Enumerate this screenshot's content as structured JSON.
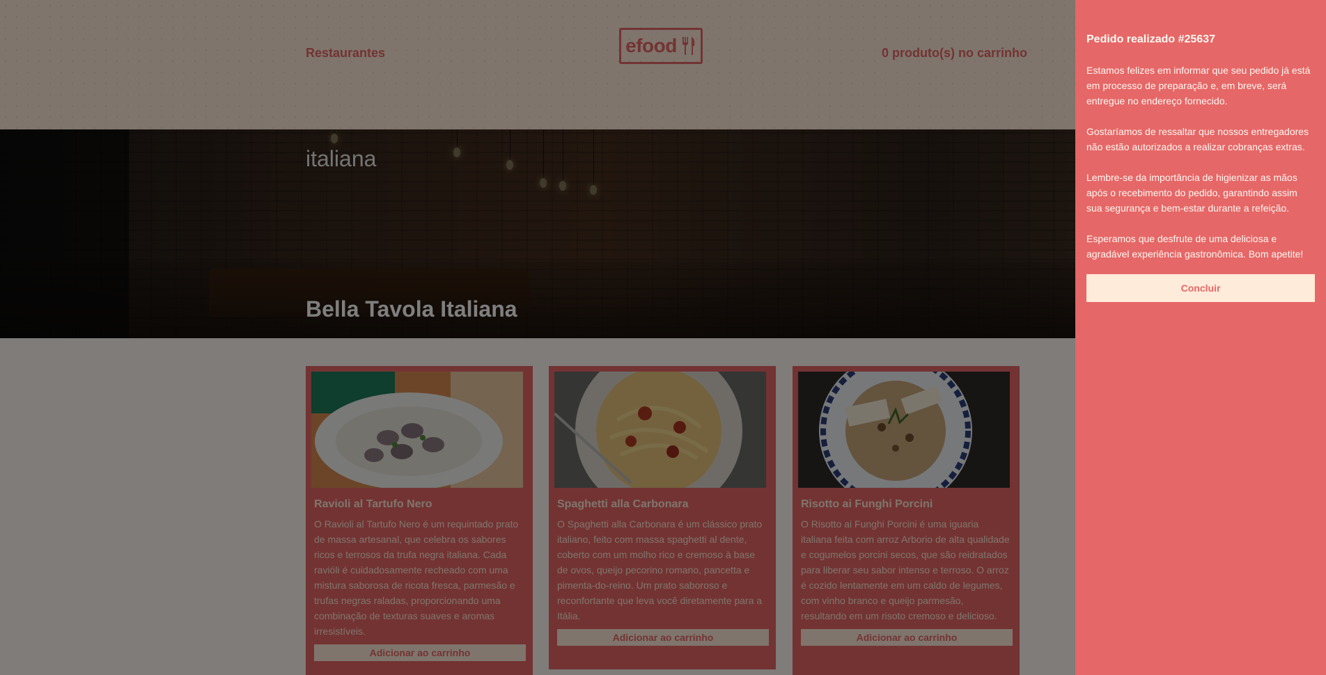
{
  "header": {
    "nav_restaurants": "Restaurantes",
    "logo_text": "efood",
    "cart_status": "0 produto(s) no carrinho"
  },
  "hero": {
    "category": "italiana",
    "restaurant_name": "Bella Tavola Italiana"
  },
  "products": [
    {
      "name": "Ravioli al Tartufo Nero",
      "description": "O Ravioli al Tartufo Nero é um requintado prato de massa artesanal, que celebra os sabores ricos e terrosos da trufa negra italiana. Cada ravióli é cuidadosamente recheado com uma mistura saborosa de ricota fresca, parmesão e trufas negras raladas, proporcionando uma combinação de texturas suaves e aromas irresistíveis.",
      "button": "Adicionar ao carrinho"
    },
    {
      "name": "Spaghetti alla Carbonara",
      "description": "O Spaghetti alla Carbonara é um clássico prato italiano, feito com massa spaghetti al dente, coberto com um molho rico e cremoso à base de ovos, queijo pecorino romano, pancetta e pimenta-do-reino. Um prato saboroso e reconfortante que leva você diretamente para a Itália.",
      "button": "Adicionar ao carrinho"
    },
    {
      "name": "Risotto ai Funghi Porcini",
      "description": "O Risotto ai Funghi Porcini é uma iguaria italiana feita com arroz Arborio de alta qualidade e cogumelos porcini secos, que são reidratados para liberar seu sabor intenso e terroso. O arroz é cozido lentamente em um caldo de legumes, com vinho branco e queijo parmesão, resultando em um risoto cremoso e delicioso.",
      "button": "Adicionar ao carrinho"
    }
  ],
  "sidebar": {
    "title": "Pedido realizado #25637",
    "paragraphs": [
      "Estamos felizes em informar que seu pedido já está em processo de preparação e, em breve, será entregue no endereço fornecido.",
      "Gostaríamos de ressaltar que nossos entregadores não estão autorizados a realizar cobranças extras.",
      "Lembre-se da importância de higienizar as mãos após o recebimento do pedido, garantindo assim sua segurança e bem-estar durante a refeição.",
      "Esperamos que desfrute de uma deliciosa e agradável experiência gastronômica. Bom apetite!"
    ],
    "button": "Concluir"
  },
  "colors": {
    "primary": "#E66767",
    "header_bg": "#FFEBD9",
    "page_bg": "#FFF8F2",
    "overlay": "rgba(0,0,0,0.5)"
  },
  "icons": {
    "logo": "fork-knife-icon"
  }
}
